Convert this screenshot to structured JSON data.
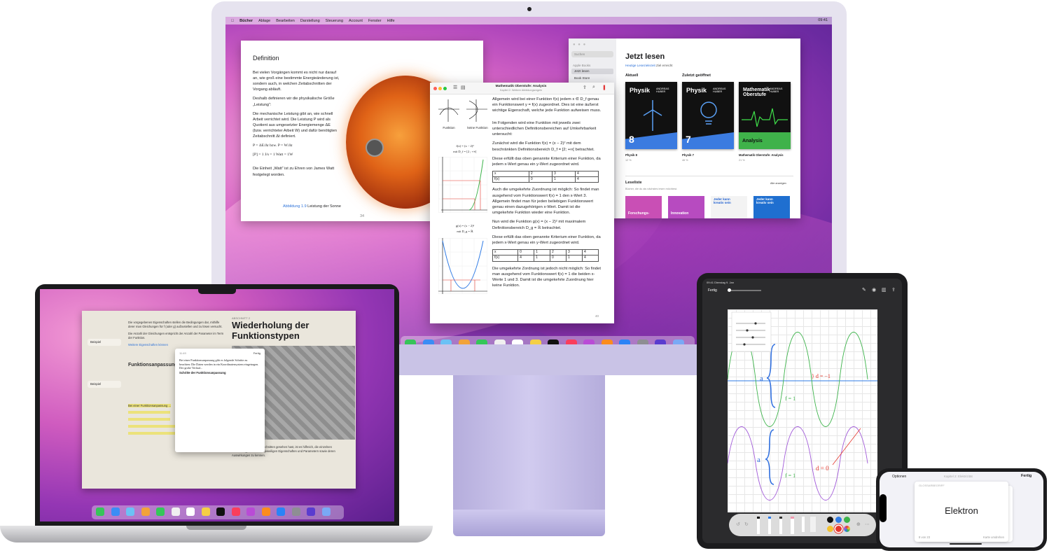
{
  "imac": {
    "menubar": {
      "items": [
        "Bücher",
        "Ablage",
        "Bearbeiten",
        "Darstellung",
        "Steuerung",
        "Account",
        "Fenster",
        "Hilfe"
      ],
      "time": "09:41"
    },
    "book_page": {
      "heading": "Definition",
      "p1": "Bei vielen Vorgängen kommt es nicht nur darauf an, wie groß eine bestimmte Energieänderung ist, sondern auch, in welchen Zeitabschnitten der Vorgang abläuft.",
      "p2": "Deshalb definieren wir die physikalische Größe „Leistung“:",
      "p3": "Die mechanische Leistung gibt an, wie schnell Arbeit verrichtet wird. Die Leistung P wird als Quotient aus umgesetzter Energiemenge ΔE (bzw. verrichteter Arbeit W) und dafür benötigten Zeitabschnitt Δt definiert.",
      "formula1": "P = ΔE/Δt  bzw. P = W/Δt",
      "formula2": "[P] = 1 J/s = 1  Watt = 1W",
      "p4": "Die Einheit „Watt“ ist zu Ehren von James Watt festgelegt worden.",
      "caption_ref": "Abbildung 1.9",
      "caption": "Leistung der Sonne",
      "page": "34"
    },
    "library": {
      "search_placeholder": "Suchen",
      "sidebar_label": "Apple Books",
      "sidebar_items": [
        "Jetzt lesen",
        "Book Store"
      ],
      "title": "Jetzt lesen",
      "goal_link": "Heutige Lesezielezeit",
      "goal_text": "Ziel erreicht",
      "section_current": "Aktuell",
      "section_recent": "Zuletzt geöffnet",
      "books": [
        {
          "cover_title": "Physik",
          "author": "ANDREAS HUBER",
          "number": "8",
          "label": "Physik 8",
          "pct": "12 %",
          "band": "#3b7be0"
        },
        {
          "cover_title": "Physik",
          "author": "ANDREAS HUBER",
          "number": "7",
          "label": "Physik 7",
          "pct": "46 %",
          "band": "#3b7be0"
        },
        {
          "cover_title": "Mathematik Oberstufe",
          "author": "ANDREAS HUBER",
          "number": "Analysis",
          "label": "Mathematik Oberstufe: Analysis",
          "pct": "21 %",
          "band": "#3fb24a"
        }
      ],
      "readlist_title": "Leseliste",
      "readlist_sub": "Bücher, die du als nächstes lesen möchtest.",
      "show_all": "Alle anzeigen",
      "readlist": [
        {
          "title": "Forschungs-",
          "color": "#c94fb5"
        },
        {
          "title": "Innovation",
          "color": "#b74bc0"
        },
        {
          "title": "Jeder kann kreativ sein",
          "color": "#f3f3f3"
        },
        {
          "title": "Jeder kann kreativ sein",
          "color": "#1f6fd0"
        }
      ]
    },
    "math": {
      "title": "Mathematik Oberstufe: Analysis",
      "subtitle": "Kapitel 2: Weitere Abbildungsregeln",
      "fig_left": "Funktion",
      "fig_right": "keine Funktion",
      "f_label": "f(x) = (x − 2)²",
      "f_domain": "mit D_f = [2 ; +∞[",
      "g_label": "g(x) = (x − 2)²",
      "g_domain": "mit D_g = ℝ",
      "p1": "Allgemein wird bei einer Funktion f(x) jedem x ∈ D_f genau ein Funktionswert y = f(x) zugeordnet. Dies ist eine äußerst wichtige Eigenschaft, welche jede Funktion aufweisen muss.",
      "p2": "Im Folgenden wird eine Funktion mit jeweils zwei unterschiedlichen Definitionsbereichen auf Umkehrbarkeit untersucht:",
      "p3": "Zunächst wird die Funktion f(x) = (x − 2)² mit dem beschränkten Definitionsbereich D_f = [2; +∞[ betrachtet.",
      "p4": "Diese erfüllt das oben genannte Kriterium einer Funktion, da jedem x-Wert genau ein y-Wert zugeordnet wird.",
      "table1": [
        [
          "x",
          "2",
          "3",
          "4"
        ],
        [
          "f(x)",
          "0",
          "1",
          "4"
        ]
      ],
      "p5": "Auch die umgekehrte Zuordnung ist möglich: So findet man ausgehend vom Funktionswert f(x) = 1 den x-Wert 3. Allgemein findet man für jeden beliebigen Funktionswert genau einen dazugehörigen x-Wert. Damit ist die umgekehrte Funktion wieder eine Funktion.",
      "p6": "Nun wird die Funktion g(x) = (x − 2)² mit maximalem Definitionsbereich D_g = ℝ betrachtet.",
      "p7": "Diese erfüllt das oben genannte Kriterium einer Funktion, da jedem x-Wert genau ein y-Wert zugeordnet wird.",
      "table2": [
        [
          "x",
          "0",
          "1",
          "2",
          "3",
          "4"
        ],
        [
          "f(x)",
          "4",
          "1",
          "0",
          "1",
          "4"
        ]
      ],
      "p8": "Die umgekehrte Zordnung ist jedoch nicht möglich: So findet man ausgehend vom Funktionswert f(x) = 1 die beiden x-Werte 1 und 3. Damit ist die umgekehrte Zuordnung hier keine Funktion.",
      "page": "40"
    },
    "dock_colors": [
      "#37c45a",
      "#3b8df5",
      "#6cc1f5",
      "#f2a33a",
      "#34c759",
      "#f0f0f0",
      "#ffffff",
      "#f5cf45",
      "#111111",
      "#fa3e5c",
      "#b94bd6",
      "#fb8c1e",
      "#2b83f6",
      "#8e8e93",
      "#5a3ccf",
      "#7aa9f5"
    ]
  },
  "macbook": {
    "p1": "Die vorgegebenen Eigenschaften stellen die Bedingungen dar, mithilfe derer man Gleichungen für f (oder g) aufzustellen und zu lösen versucht.",
    "p2": "Die Anzahl der Gleichungen entspricht der Anzahl der Parameter im Term der Funktion.",
    "p3": "Weitere Eigenschaften können",
    "side1": "Beispiel",
    "side2": "Beispiel",
    "sec": "Funktionsanpassung",
    "hl1": "Bei einer Funktionsanpassung ...",
    "kapitel": "ABSCHNITT 2",
    "title": "Wiederholung der Funktionstypen",
    "p_bottom": "Wie du in den letzten Abschnitten gesehen hast, ist es hilfreich, die einzelnen Funktionstypen mit ihren jeweiligen Eigenschaften und Parametern sowie deren Auswirkungen zu kennen.",
    "note_time": "11:49",
    "note_done": "Fertig",
    "note_body": "Bei einer Funktionsanpassung gibt es folgende Schritte zu beachten: Die Daten werden in ein Koordinatensystem eingetragen. Der grobe Verlauf...",
    "note_title": "Schritte der Funktionsanpassung"
  },
  "ipad": {
    "status": "09:41  Dienstag 9. Jan",
    "done": "Fertig",
    "colors": [
      "#111111",
      "#2f7be5",
      "#3cb34a",
      "#f2c230",
      "#e5392f",
      "#a25bd9"
    ]
  },
  "iphone": {
    "options": "Optionen",
    "chapter": "Kapitel 2: Elektrizität",
    "done": "Fertig",
    "card_kind": "GLOSSARBEGRIFF",
    "word": "Elektron",
    "progress": "8 von 23",
    "flip": "Karte umdrehen"
  }
}
